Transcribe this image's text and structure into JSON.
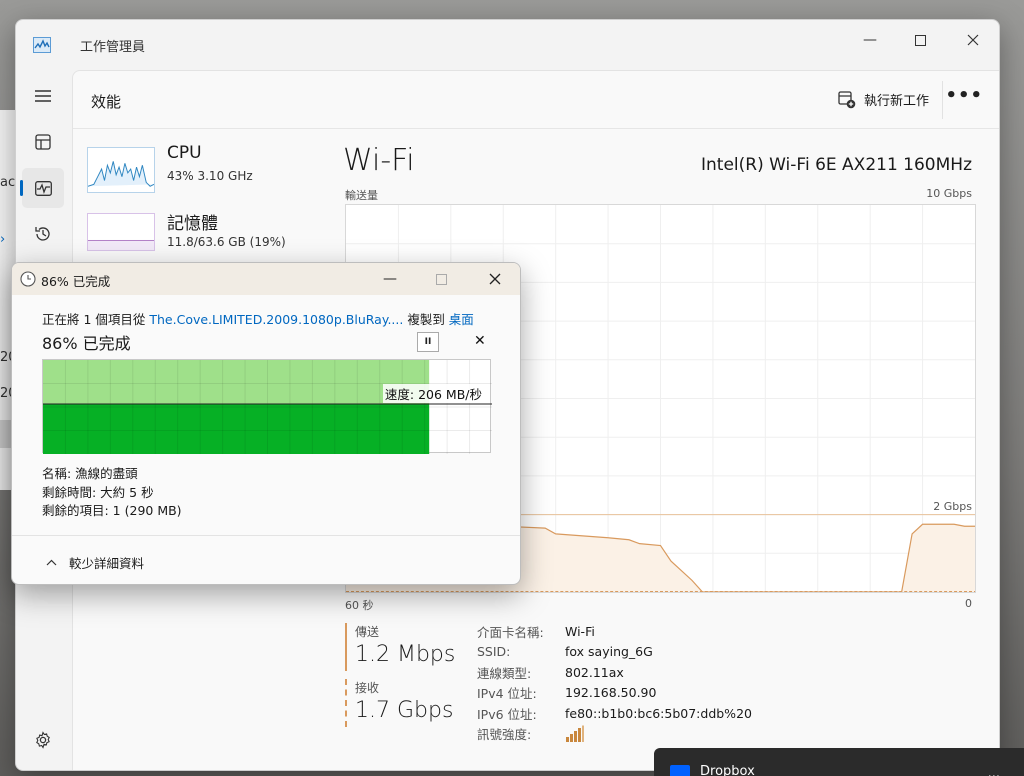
{
  "background_window": {
    "fragments": [
      "acl",
      "20",
      "20"
    ]
  },
  "task_manager": {
    "title": "工作管理員",
    "page_title": "效能",
    "run_new_task": "執行新工作",
    "more": "•••",
    "rail_icons": [
      "hamburger-icon",
      "processes-icon",
      "performance-icon",
      "app-history-icon",
      "settings-icon"
    ],
    "sidebar": [
      {
        "name": "CPU",
        "sub": "43% 3.10 GHz"
      },
      {
        "name": "記憶體",
        "sub": "11.8/63.6 GB (19%)"
      }
    ],
    "main": {
      "title": "Wi-Fi",
      "adapter": "Intel(R) Wi-Fi 6E AX211 160MHz",
      "axis_top_left": "輸送量",
      "axis_top_right": "10 Gbps",
      "mid_label": "2 Gbps",
      "axis_bottom_left": "60 秒",
      "axis_bottom_right": "0",
      "send_label": "傳送",
      "send_value": "1.2 Mbps",
      "recv_label": "接收",
      "recv_value": "1.7 Gbps",
      "properties": [
        {
          "k": "介面卡名稱:",
          "v": "Wi-Fi"
        },
        {
          "k": "SSID:",
          "v": "fox saying_6G"
        },
        {
          "k": "連線類型:",
          "v": "802.11ax"
        },
        {
          "k": "IPv4 位址:",
          "v": "192.168.50.90"
        },
        {
          "k": "IPv6 位址:",
          "v": "fe80::b1b0:bc6:5b07:ddb%20"
        },
        {
          "k": "訊號強度:",
          "v": ""
        }
      ]
    },
    "chart_data": {
      "type": "line",
      "title": "Wi-Fi",
      "ylabel": "輸送量",
      "ylim": [
        0,
        10
      ],
      "unit": "Gbps",
      "xlim": [
        60,
        0
      ],
      "x": [
        60,
        55,
        50,
        45,
        41,
        40,
        35,
        33,
        32,
        30,
        29,
        27,
        26,
        24,
        20,
        10,
        7,
        6,
        5,
        4,
        2,
        1,
        0
      ],
      "series": [
        {
          "name": "接收",
          "values": [
            1.7,
            1.7,
            1.7,
            1.7,
            1.65,
            1.5,
            1.4,
            1.35,
            1.25,
            1.2,
            0.8,
            0.3,
            0,
            0,
            0,
            0,
            0,
            1.5,
            1.75,
            1.75,
            1.75,
            1.7,
            1.7
          ]
        },
        {
          "name": "傳送",
          "values": [
            0.01,
            0.01,
            0.01,
            0.01,
            0.01,
            0.01,
            0.01,
            0.01,
            0.01,
            0.01,
            0.01,
            0.01,
            0.01,
            0.01,
            0.01,
            0.01,
            0.01,
            0.01,
            0.01,
            0.01,
            0.01,
            0.01,
            0.01
          ]
        }
      ],
      "grid": true
    }
  },
  "copy_dialog": {
    "title": "86% 已完成",
    "line_prefix": "正在將 1 個項目從 ",
    "source": "The.Cove.LIMITED.2009.1080p.BluRay....",
    "line_mid": " 複製到 ",
    "dest": "桌面",
    "percent_text": "86% 已完成",
    "progress": 0.86,
    "speed": "速度: 206 MB/秒",
    "name_line": "名稱: 漁線的盡頭",
    "time_line": "剩餘時間: 大約 5 秒",
    "items_line": "剩餘的項目: 1 (290 MB)",
    "details": "較少詳細資料",
    "pause": "II",
    "cancel": "✕"
  },
  "notification": {
    "app": "Dropbox",
    "more": "..."
  },
  "colors": {
    "accent": "#0067c0",
    "wifi_line": "#d99a5e",
    "progress_light": "#9fe08a",
    "progress_dark": "#06b025"
  }
}
